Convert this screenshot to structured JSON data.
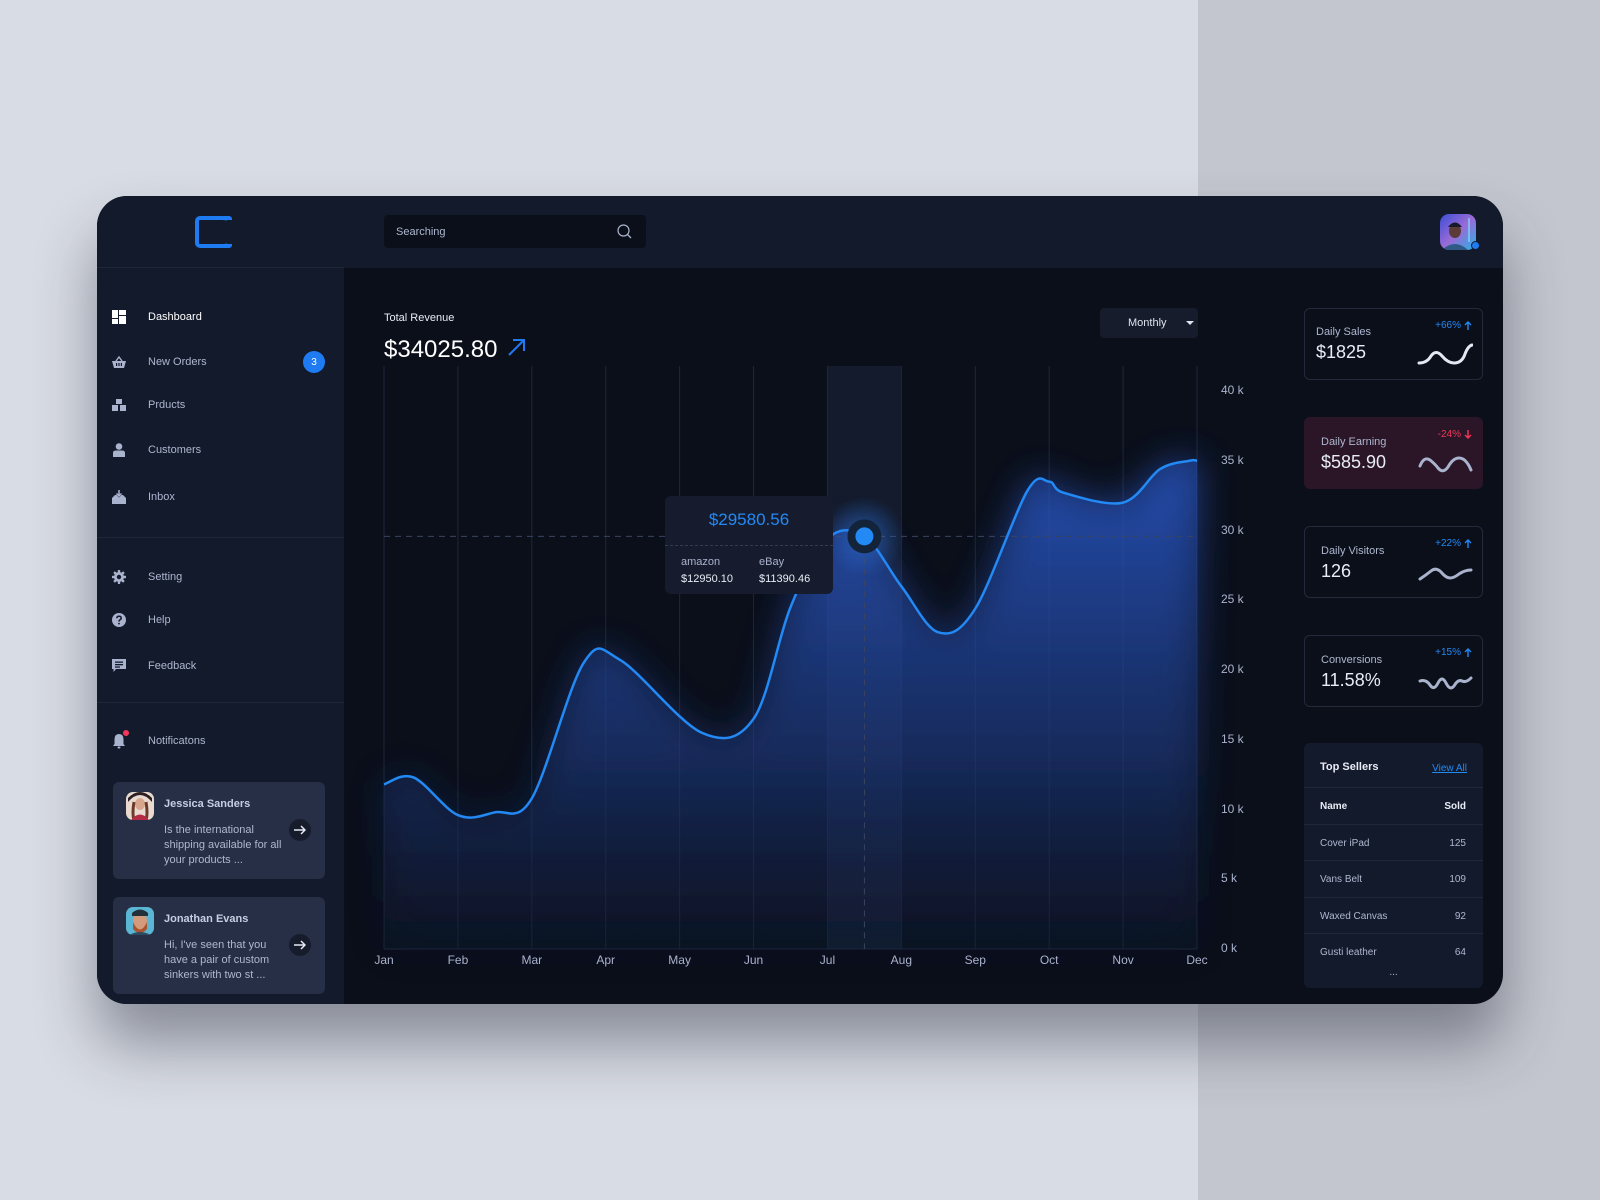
{
  "sidebar": {
    "logo": "C",
    "nav_main": [
      {
        "label": "Dashboard",
        "icon": "dashboard-icon",
        "active": true
      },
      {
        "label": "New Orders",
        "icon": "basket-icon",
        "badge": "3"
      },
      {
        "label": "Prducts",
        "icon": "boxes-icon"
      },
      {
        "label": "Customers",
        "icon": "person-icon"
      },
      {
        "label": "Inbox",
        "icon": "inbox-icon"
      }
    ],
    "nav_secondary": [
      {
        "label": "Setting",
        "icon": "gear-icon"
      },
      {
        "label": "Help",
        "icon": "help-icon"
      },
      {
        "label": "Feedback",
        "icon": "feedback-icon"
      }
    ],
    "notifications": {
      "label": "Notificatons",
      "icon": "bell-icon",
      "has_unread": true
    },
    "messages": [
      {
        "name": "Jessica Sanders",
        "text": "Is the international shipping available for all your products ..."
      },
      {
        "name": "Jonathan Evans",
        "text": "Hi, I've  seen that you have a pair of custom sinkers with two st ..."
      }
    ]
  },
  "topbar": {
    "search_placeholder": "Searching",
    "user_online": true
  },
  "revenue": {
    "label": "Total Revenue",
    "value": "$34025.80",
    "period": "Monthly"
  },
  "tooltip": {
    "total": "$29580.56",
    "sources": [
      {
        "label": "amazon",
        "value": "$12950.10"
      },
      {
        "label": "eBay",
        "value": "$11390.46"
      }
    ]
  },
  "chart_data": {
    "type": "area",
    "title": "Total Revenue",
    "categories": [
      "Jan",
      "Feb",
      "Mar",
      "Apr",
      "May",
      "Jun",
      "Jul",
      "Aug",
      "Sep",
      "Oct",
      "Nov",
      "Dec"
    ],
    "x": [
      0,
      0.4,
      1,
      1.5,
      2,
      2.7,
      3.2,
      4.3,
      5,
      5.5,
      6,
      6.5,
      7,
      7.5,
      8,
      8.7,
      9,
      9.2,
      10,
      10.5,
      10.9,
      11
    ],
    "series": [
      {
        "name": "Revenue",
        "values": [
          11800,
          12300,
          9600,
          9800,
          10800,
          20500,
          20700,
          15500,
          16500,
          24500,
          29400,
          29580,
          26000,
          22700,
          24400,
          32800,
          33500,
          32700,
          32000,
          34400,
          35000,
          35000
        ]
      }
    ],
    "yticks": [
      "0 k",
      "5 k",
      "10 k",
      "15 k",
      "20 k",
      "25 k",
      "30 k",
      "35 k",
      "40 k"
    ],
    "ylim": [
      0,
      40000
    ],
    "highlight": {
      "category": "Jul",
      "value": 29580.56
    },
    "grid": true,
    "legend": "none"
  },
  "stats": [
    {
      "title": "Daily Sales",
      "value": "$1825",
      "change": "+66%",
      "direction": "up"
    },
    {
      "title": "Daily Earning",
      "value": "$585.90",
      "change": "-24%",
      "direction": "down"
    },
    {
      "title": "Daily Visitors",
      "value": "126",
      "change": "+22%",
      "direction": "up"
    },
    {
      "title": "Conversions",
      "value": "11.58%",
      "change": "+15%",
      "direction": "up"
    }
  ],
  "top_sellers": {
    "title": "Top Sellers",
    "view_all": "View All",
    "columns": [
      "Name",
      "Sold"
    ],
    "rows": [
      {
        "name": "Cover iPad",
        "sold": "125"
      },
      {
        "name": "Vans Belt",
        "sold": "109"
      },
      {
        "name": "Waxed Canvas",
        "sold": "92"
      },
      {
        "name": "Gusti leather",
        "sold": "64"
      }
    ],
    "more": "..."
  },
  "colors": {
    "accent": "#1f7bf2",
    "negative": "#f2385a",
    "background": "#0b0f1a",
    "panel": "#131a2b"
  }
}
